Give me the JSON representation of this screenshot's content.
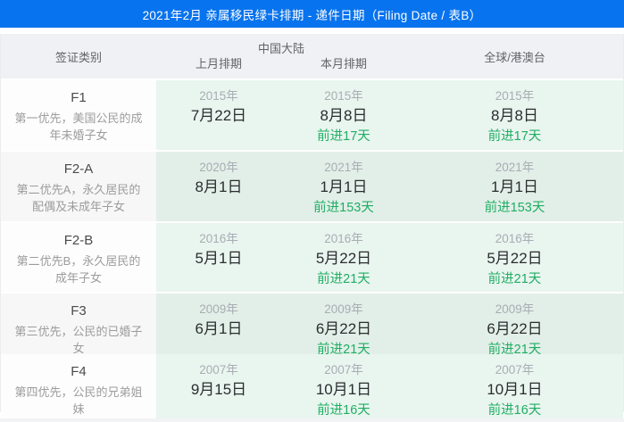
{
  "title_bar": {
    "text": "2021年2月 亲属移民绿卡排期 - 递件日期（Filing Date / 表B）"
  },
  "table": {
    "headers": {
      "category": "签证类别",
      "china_group": "中国大陆",
      "last_month": "上月排期",
      "this_month": "本月排期",
      "global": "全球/港澳台"
    },
    "rows": [
      {
        "code": "F1",
        "desc": "第一优先，美国公民的成年未婚子女",
        "last": {
          "year": "2015年",
          "date": "7月22日"
        },
        "this": {
          "year": "2015年",
          "date": "8月8日",
          "advance": "前进17天"
        },
        "global": {
          "year": "2015年",
          "date": "8月8日",
          "advance": "前进17天"
        }
      },
      {
        "code": "F2-A",
        "desc": "第二优先A，永久居民的配偶及未成年子女",
        "last": {
          "year": "2020年",
          "date": "8月1日"
        },
        "this": {
          "year": "2021年",
          "date": "1月1日",
          "advance": "前进153天"
        },
        "global": {
          "year": "2021年",
          "date": "1月1日",
          "advance": "前进153天"
        }
      },
      {
        "code": "F2-B",
        "desc": "第二优先B，永久居民的成年子女",
        "last": {
          "year": "2016年",
          "date": "5月1日"
        },
        "this": {
          "year": "2016年",
          "date": "5月22日",
          "advance": "前进21天"
        },
        "global": {
          "year": "2016年",
          "date": "5月22日",
          "advance": "前进21天"
        }
      },
      {
        "code": "F3",
        "desc": "第三优先，公民的已婚子女",
        "last": {
          "year": "2009年",
          "date": "6月1日"
        },
        "this": {
          "year": "2009年",
          "date": "6月22日",
          "advance": "前进21天"
        },
        "global": {
          "year": "2009年",
          "date": "6月22日",
          "advance": "前进21天"
        }
      },
      {
        "code": "F4",
        "desc": "第四优先，公民的兄弟姐妹",
        "last": {
          "year": "2007年",
          "date": "9月15日"
        },
        "this": {
          "year": "2007年",
          "date": "10月1日",
          "advance": "前进16天"
        },
        "global": {
          "year": "2007年",
          "date": "10月1日",
          "advance": "前进16天"
        }
      }
    ]
  },
  "colors": {
    "accent_blue": "#0873ee",
    "advance_green": "#1fae63",
    "cell_green_light": "#e9f5ef",
    "cell_green_dark": "#e2efe8",
    "header_bg": "#eff1f5"
  }
}
